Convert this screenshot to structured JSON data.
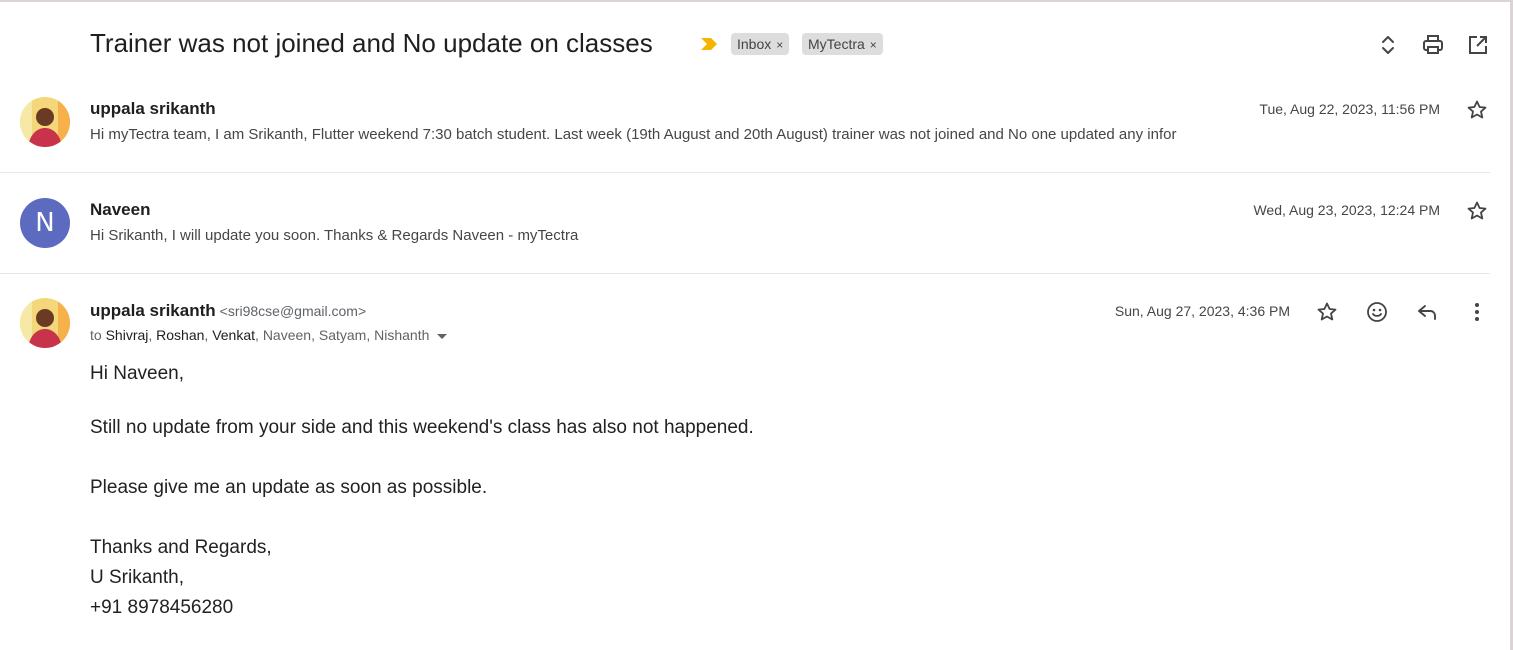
{
  "thread": {
    "subject": "Trainer was not joined and No update on classes",
    "labels": [
      {
        "name": "Inbox",
        "remove": "×"
      },
      {
        "name": "MyTectra",
        "remove": "×"
      }
    ],
    "header_icons": [
      "expand-collapse-icon",
      "print-icon",
      "open-new-window-icon"
    ]
  },
  "messages": [
    {
      "sender": "uppala srikanth",
      "date": "Tue, Aug 22, 2023, 11:56 PM",
      "snippet": "Hi myTectra team, I am Srikanth, Flutter weekend 7:30 batch student. Last week (19th August and 20th August) trainer was not joined and No one updated any infor",
      "avatar": "photo"
    },
    {
      "sender": "Naveen",
      "date": "Wed, Aug 23, 2023, 12:24 PM",
      "snippet": "Hi Srikanth, I will update you soon. Thanks & Regards Naveen - myTectra",
      "avatar_letter": "N",
      "avatar_color": "#5c6bc0"
    }
  ],
  "open_message": {
    "sender": "uppala srikanth",
    "email": "<sri98cse@gmail.com>",
    "date": "Sun, Aug 27, 2023, 4:36 PM",
    "to_prefix": "to",
    "recipients": [
      {
        "name": "Shivraj",
        "sep": ", "
      },
      {
        "name": "Roshan",
        "sep": ", "
      },
      {
        "name": "Venkat",
        "sep": ", "
      },
      {
        "name": "Naveen",
        "sep": ", "
      },
      {
        "name": "Satyam",
        "sep": ", "
      },
      {
        "name": "Nishanth",
        "sep": ""
      }
    ],
    "body": [
      "Hi Naveen,",
      "Still no update from your side and this weekend's class has also not happened.",
      "Please give me an update as soon as possible.",
      "Thanks and Regards,",
      "U Srikanth,",
      "+91 8978456280"
    ],
    "action_icons": [
      "star-icon",
      "emoji-react-icon",
      "reply-icon",
      "more-options-icon"
    ]
  },
  "colors": {
    "important_marker": "#f4b400",
    "chip_bg": "#dddddd",
    "avatar_n": "#5c6bc0"
  }
}
